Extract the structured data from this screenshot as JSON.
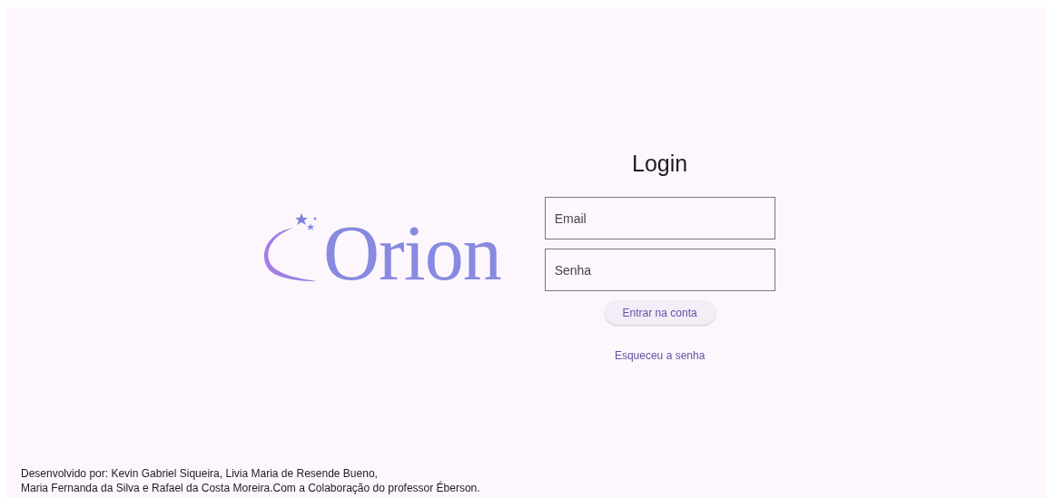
{
  "logo": {
    "text": "Orion"
  },
  "login": {
    "title": "Login",
    "fields": [
      {
        "placeholder": "Email"
      },
      {
        "placeholder": "Senha"
      }
    ],
    "submit": "Entrar na conta",
    "forgot": "Esqueceu a senha"
  },
  "footer": [
    "Desenvolvido por: Kevin Gabriel Siqueira, Livia Maria de Resende Bueno,",
    "Maria Fernanda da Silva e Rafael da Costa Moreira.Com a Colaboração do professor Éberson."
  ]
}
